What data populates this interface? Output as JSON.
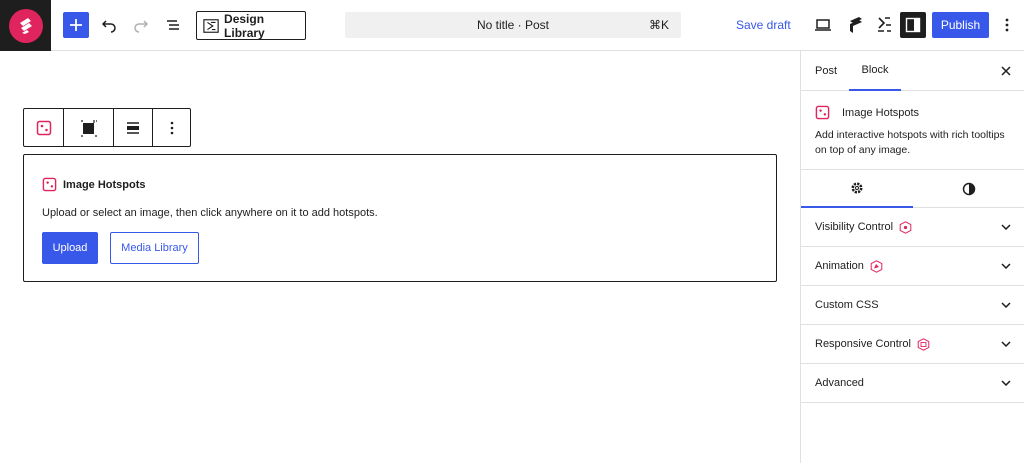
{
  "toolbar": {
    "design_library_label": "Design Library",
    "document_title": "No title · Post",
    "command_shortcut": "⌘K",
    "save_draft_label": "Save draft",
    "publish_label": "Publish"
  },
  "block": {
    "name": "Image Hotspots",
    "placeholder_description": "Upload or select an image, then click anywhere on it to add hotspots.",
    "upload_label": "Upload",
    "media_library_label": "Media Library"
  },
  "sidebar": {
    "tabs": [
      {
        "label": "Post",
        "active": false
      },
      {
        "label": "Block",
        "active": true
      }
    ],
    "block_card": {
      "title": "Image Hotspots",
      "description": "Add interactive hotspots with rich tooltips on top of any image."
    },
    "panels": [
      {
        "label": "Visibility Control",
        "badge": true
      },
      {
        "label": "Animation",
        "badge": true
      },
      {
        "label": "Custom CSS",
        "badge": false
      },
      {
        "label": "Responsive Control",
        "badge": true
      },
      {
        "label": "Advanced",
        "badge": false
      }
    ]
  },
  "colors": {
    "accent": "#3858e9",
    "brand": "#e0245e",
    "dark": "#1e1e1e"
  }
}
